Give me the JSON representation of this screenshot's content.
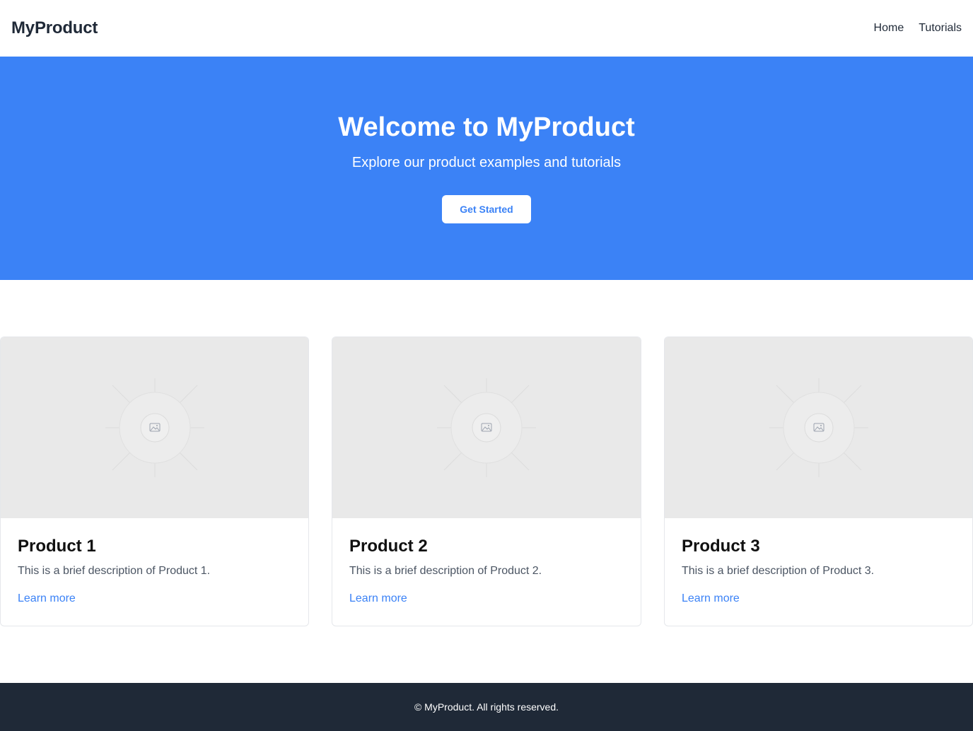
{
  "header": {
    "logo": "MyProduct",
    "nav": [
      {
        "label": "Home"
      },
      {
        "label": "Tutorials"
      }
    ]
  },
  "hero": {
    "title": "Welcome to MyProduct",
    "subtitle": "Explore our product examples and tutorials",
    "cta_label": "Get Started",
    "background": "#3b82f6"
  },
  "products": [
    {
      "title": "Product 1",
      "description": "This is a brief description of Product 1.",
      "link_label": "Learn more",
      "image_icon": "image-placeholder-icon"
    },
    {
      "title": "Product 2",
      "description": "This is a brief description of Product 2.",
      "link_label": "Learn more",
      "image_icon": "image-placeholder-icon"
    },
    {
      "title": "Product 3",
      "description": "This is a brief description of Product 3.",
      "link_label": "Learn more",
      "image_icon": "image-placeholder-icon"
    }
  ],
  "footer": {
    "text": "© MyProduct. All rights reserved.",
    "background": "#1f2937"
  },
  "colors": {
    "accent": "#3b82f6",
    "dark": "#1f2937"
  }
}
